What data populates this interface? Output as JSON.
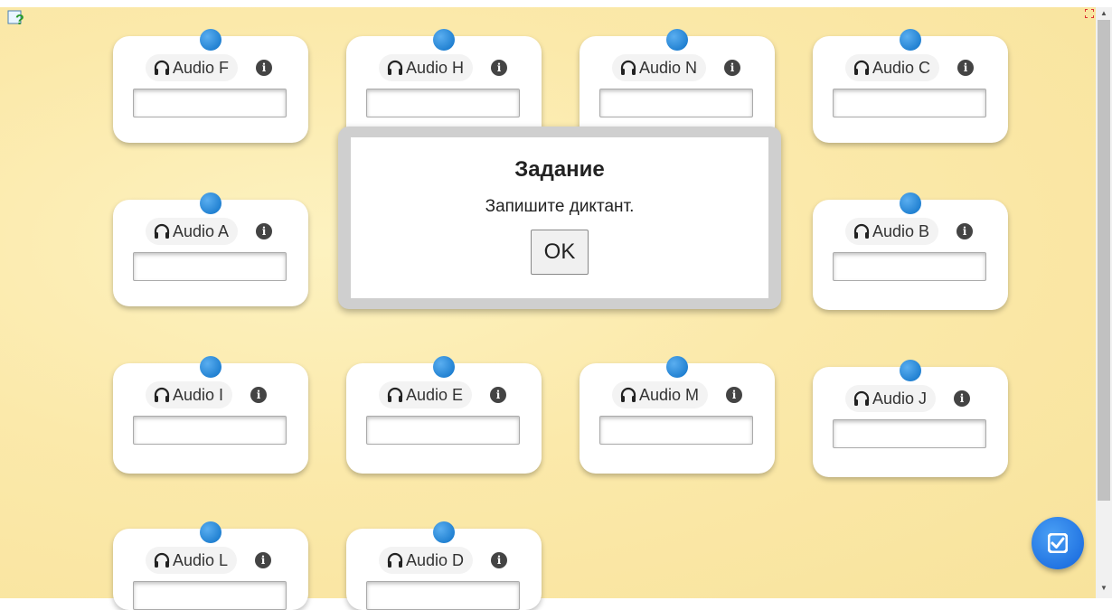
{
  "cards": [
    {
      "label": "Audio F",
      "value": ""
    },
    {
      "label": "Audio H",
      "value": ""
    },
    {
      "label": "Audio N",
      "value": ""
    },
    {
      "label": "Audio C",
      "value": ""
    },
    {
      "label": "Audio A",
      "value": ""
    },
    {
      "label": "Audio B",
      "value": ""
    },
    {
      "label": "Audio I",
      "value": ""
    },
    {
      "label": "Audio E",
      "value": ""
    },
    {
      "label": "Audio M",
      "value": ""
    },
    {
      "label": "Audio J",
      "value": ""
    },
    {
      "label": "Audio L",
      "value": ""
    },
    {
      "label": "Audio D",
      "value": ""
    }
  ],
  "modal": {
    "title": "Задание",
    "text": "Запишите диктант.",
    "ok_label": "OK"
  },
  "icons": {
    "help": "help-icon",
    "fullscreen": "fullscreen-icon",
    "headphones": "headphones-icon",
    "info": "info-icon",
    "check": "check-icon",
    "info_glyph": "i"
  },
  "colors": {
    "pin": "#2f8fe0",
    "check_button": "#1d6fe0",
    "board": "#fbe9aa"
  }
}
